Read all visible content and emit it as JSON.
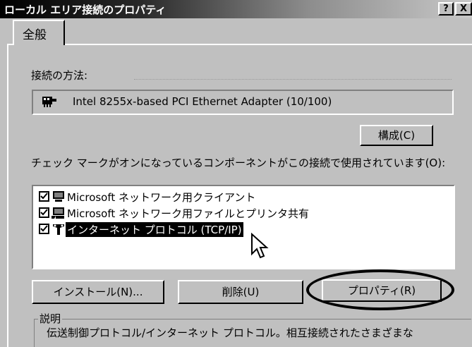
{
  "window": {
    "title": "ローカル エリア接続のプロパティ",
    "help_label": "?",
    "close_label": "X"
  },
  "tabs": [
    {
      "label": "全般"
    }
  ],
  "connection": {
    "label": "接続の方法:",
    "adapter_name": "Intel 8255x-based PCI Ethernet Adapter (10/100)",
    "configure_label": "構成(C)"
  },
  "components": {
    "label": "チェック マークがオンになっているコンポーネントがこの接続で使用されています(O):",
    "items": [
      {
        "label": "Microsoft ネットワーク用クライアント",
        "checked": true,
        "icon": "network-client-icon"
      },
      {
        "label": "Microsoft ネットワーク用ファイルとプリンタ共有",
        "checked": true,
        "icon": "file-printer-sharing-icon"
      },
      {
        "label": "インターネット プロトコル (TCP/IP)",
        "checked": true,
        "icon": "protocol-icon",
        "selected": true
      }
    ]
  },
  "buttons": {
    "install": "インストール(N)...",
    "uninstall": "削除(U)",
    "properties": "プロパティ(R)"
  },
  "description": {
    "label": "説明",
    "text": "伝送制御プロトコル/インターネット プロトコル。相互接続されたさまざまな"
  }
}
